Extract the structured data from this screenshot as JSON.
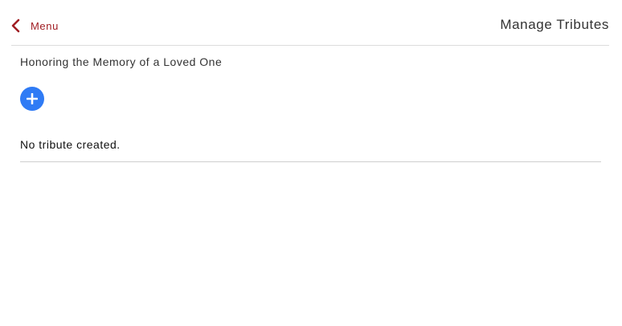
{
  "header": {
    "back_label": "Menu",
    "title": "Manage Tributes"
  },
  "main": {
    "heading": "Honoring the Memory of a Loved One",
    "add_button_icon": "plus-icon",
    "empty_message": "No tribute created."
  },
  "colors": {
    "accent_red": "#a01e24",
    "add_button_blue": "#2f7bf5"
  },
  "icons": {
    "back": "chevron-left-icon",
    "add": "plus-icon"
  }
}
